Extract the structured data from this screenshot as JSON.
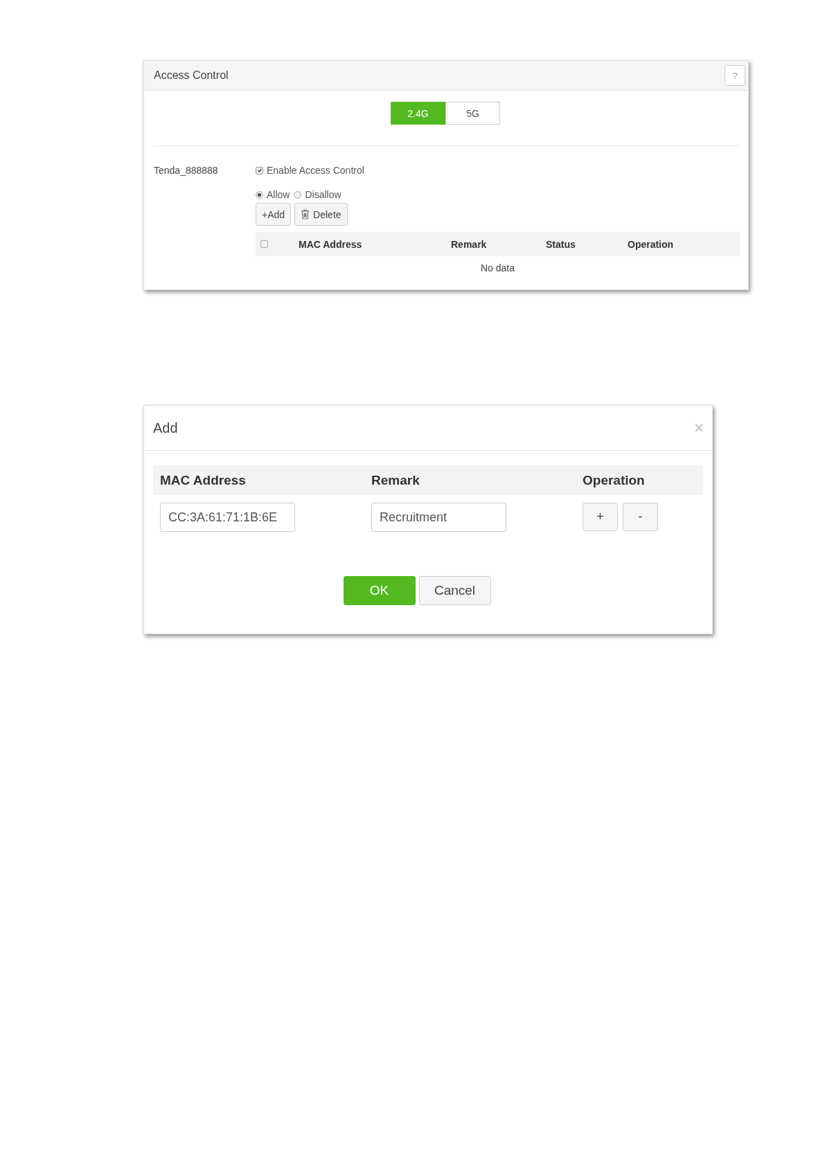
{
  "access_control": {
    "title": "Access Control",
    "help": "?",
    "bands": [
      {
        "label": "2.4G",
        "selected": true
      },
      {
        "label": "5G",
        "selected": false
      }
    ],
    "ssid": "Tenda_888888",
    "enable": {
      "label": "Enable Access Control",
      "checked": true
    },
    "modes": [
      {
        "label": "Allow",
        "selected": true
      },
      {
        "label": "Disallow",
        "selected": false
      }
    ],
    "buttons": [
      {
        "kind": "add",
        "label": "+Add"
      },
      {
        "kind": "delete",
        "label": "Delete"
      }
    ],
    "table": {
      "select_all": {
        "checked": false
      },
      "columns": [
        "MAC Address",
        "Remark",
        "Status",
        "Operation"
      ],
      "empty_text": "No data"
    }
  },
  "add_dialog": {
    "title": "Add",
    "close": "×",
    "columns": [
      "MAC Address",
      "Remark",
      "Operation"
    ],
    "rows": [
      {
        "mac": "CC:3A:61:71:1B:6E",
        "remark": "Recruitment",
        "actions": [
          "+",
          "-"
        ]
      }
    ],
    "buttons": [
      {
        "kind": "primary",
        "label": "OK"
      },
      {
        "kind": "secondary",
        "label": "Cancel"
      }
    ]
  }
}
